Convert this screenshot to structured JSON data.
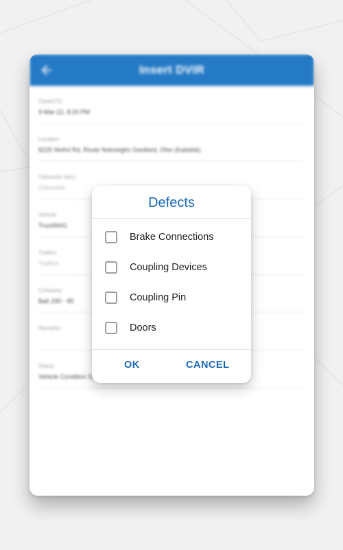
{
  "app": {
    "title": "Insert DVIR",
    "header_color": "#1a73c2"
  },
  "form": {
    "fields": [
      {
        "label": "Date/UTC",
        "value": "9-Mar-22, 8:20 PM"
      },
      {
        "label": "Location",
        "value": "8225 Wofrd Rd, Route Nokneighn Geofeed, Ohio (Kabidsk)",
        "placeholder": false
      },
      {
        "label": "Odometer (km)",
        "value": "Odometer",
        "placeholder": true
      },
      {
        "label": "Vehicle",
        "value": "Truck8441"
      },
      {
        "label": "Trailers",
        "value": "Trailers",
        "placeholder": true
      },
      {
        "label": "Company",
        "value": "Bah 290 - 85"
      },
      {
        "label": "Remarks",
        "value": ""
      },
      {
        "label": "Status",
        "value": "Vehicle Condition Satisfactory"
      }
    ]
  },
  "dialog": {
    "title": "Defects",
    "options": [
      {
        "label": "Brake Connections",
        "checked": false
      },
      {
        "label": "Coupling Devices",
        "checked": false
      },
      {
        "label": "Coupling Pin",
        "checked": false
      },
      {
        "label": "Doors",
        "checked": false
      }
    ],
    "ok_label": "OK",
    "cancel_label": "CANCEL",
    "accent_color": "#1769b6"
  },
  "icons": {
    "back": "arrow-left-icon",
    "checkbox": "checkbox-unchecked-icon"
  }
}
